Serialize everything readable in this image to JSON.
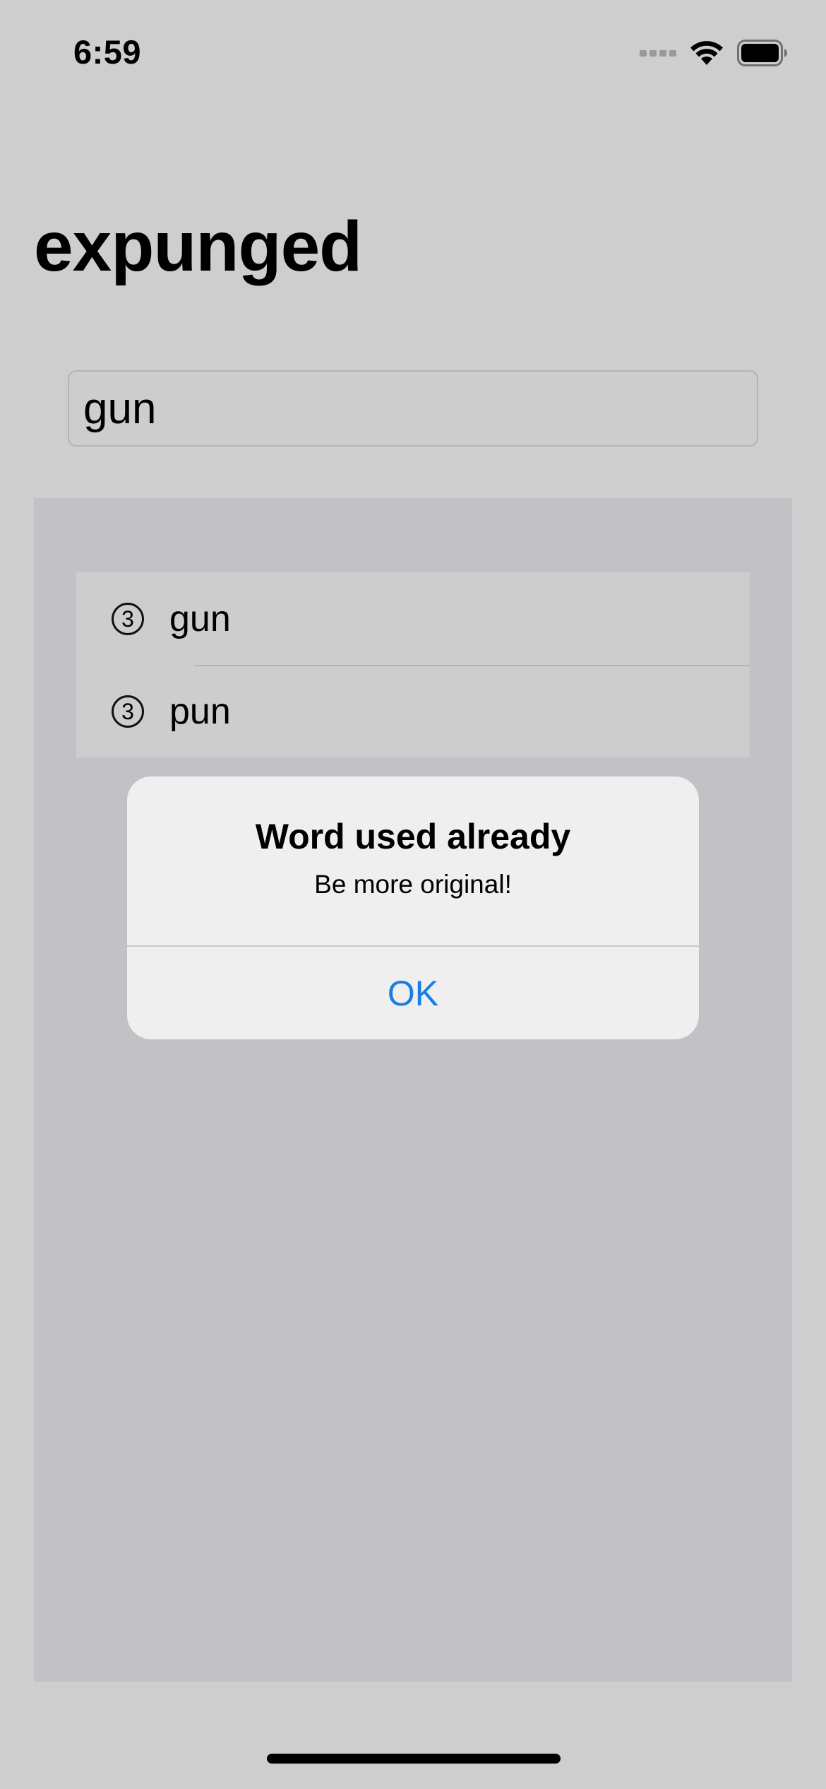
{
  "status_bar": {
    "time": "6:59"
  },
  "page": {
    "title": "expunged"
  },
  "input": {
    "value": "gun"
  },
  "used_words": [
    {
      "count": "3",
      "word": "gun"
    },
    {
      "count": "3",
      "word": "pun"
    }
  ],
  "alert": {
    "title": "Word used already",
    "message": "Be more original!",
    "ok_label": "OK"
  },
  "colors": {
    "accent": "#1a7de3",
    "background": "#cecece",
    "list_background": "#c2c1c5",
    "alert_background": "#efeff0"
  }
}
